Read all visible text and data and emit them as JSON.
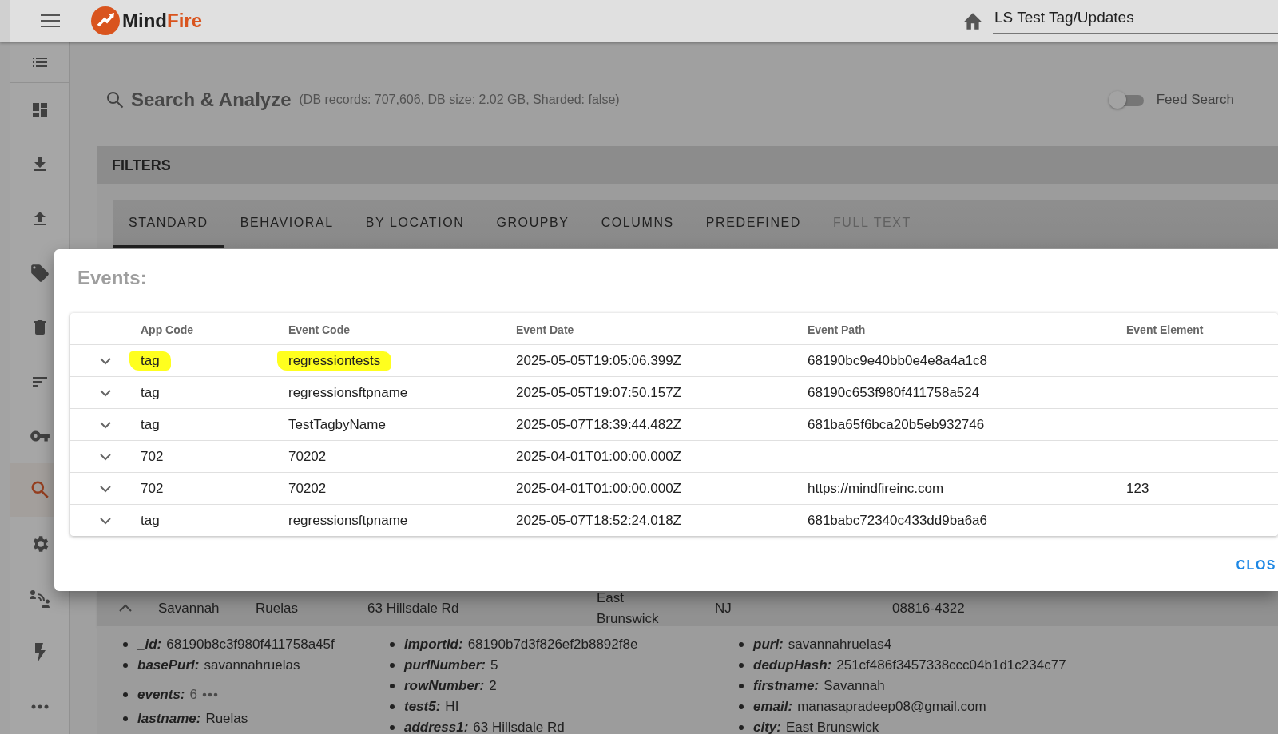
{
  "top_bar": {
    "logo": {
      "text": "Mind",
      "accent": "Fire"
    },
    "breadcrumb": "LS Test Tag/Updates"
  },
  "sidebar": {
    "items": [
      {
        "kind": "list",
        "selected": false
      },
      {
        "kind": "dashboard",
        "selected": false
      },
      {
        "kind": "download",
        "selected": false
      },
      {
        "kind": "upload",
        "selected": false
      },
      {
        "kind": "tag",
        "selected": false
      },
      {
        "kind": "trash",
        "selected": false
      },
      {
        "kind": "sort",
        "selected": false
      },
      {
        "kind": "key",
        "selected": false
      },
      {
        "kind": "search",
        "selected": true
      },
      {
        "kind": "gear",
        "selected": false
      },
      {
        "kind": "people",
        "selected": false
      },
      {
        "kind": "bolt",
        "selected": false
      },
      {
        "kind": "more",
        "selected": false
      }
    ]
  },
  "header": {
    "title": "Search & Analyze",
    "subtitle": "(DB records: 707,606, DB size: 2.02 GB, Sharded: false)",
    "feed_search": {
      "label": "Feed Search",
      "on": false
    }
  },
  "filters": {
    "title": "FILTERS",
    "tabs": [
      {
        "label": "STANDARD",
        "selected": true,
        "disabled": false
      },
      {
        "label": "BEHAVIORAL",
        "selected": false,
        "disabled": false
      },
      {
        "label": "BY LOCATION",
        "selected": false,
        "disabled": false
      },
      {
        "label": "GROUPBY",
        "selected": false,
        "disabled": false
      },
      {
        "label": "COLUMNS",
        "selected": false,
        "disabled": false
      },
      {
        "label": "PREDEFINED",
        "selected": false,
        "disabled": false
      },
      {
        "label": "FULL TEXT",
        "selected": false,
        "disabled": true
      }
    ]
  },
  "record": {
    "expanded": true,
    "cells": [
      "Savannah",
      "Ruelas",
      "63 Hillsdale Rd",
      "East Brunswick",
      "NJ",
      "08816-4322"
    ],
    "details": [
      [
        {
          "key": "_id:",
          "value": "68190b8c3f980f411758a45f"
        },
        {
          "key": "basePurl:",
          "value": "savannahruelas"
        },
        {
          "key": "events:",
          "value": "6",
          "kind": "more"
        },
        {
          "key": "lastname:",
          "value": "Ruelas"
        }
      ],
      [
        {
          "key": "importId:",
          "value": "68190b7d3f826ef2b8892f8e"
        },
        {
          "key": "purlNumber:",
          "value": "5"
        },
        {
          "key": "rowNumber:",
          "value": "2"
        },
        {
          "key": "test5:",
          "value": "HI"
        },
        {
          "key": "address1:",
          "value": "63 Hillsdale Rd"
        }
      ],
      [
        {
          "key": "purl:",
          "value": "savannahruelas4"
        },
        {
          "key": "dedupHash:",
          "value": "251cf486f3457338ccc04b1d1c234c77"
        },
        {
          "key": "firstname:",
          "value": "Savannah"
        },
        {
          "key": "email:",
          "value": "manasapradeep08@gmail.com"
        },
        {
          "key": "city:",
          "value": "East Brunswick"
        }
      ]
    ]
  },
  "dialog": {
    "title": "Events:",
    "columns": [
      "App Code",
      "Event Code",
      "Event Date",
      "Event Path",
      "Event Element"
    ],
    "rows": [
      {
        "app_code": "tag",
        "event_code": "regressiontests",
        "event_date": "2025-05-05T19:05:06.399Z",
        "event_path": "68190bc9e40bb0e4e8a4a1c8",
        "highlighted": true
      },
      {
        "app_code": "tag",
        "event_code": "regressionsftpname",
        "event_date": "2025-05-05T19:07:50.157Z",
        "event_path": "68190c653f980f411758a524",
        "highlighted": false
      },
      {
        "app_code": "tag",
        "event_code": "TestTagbyName",
        "event_date": "2025-05-07T18:39:44.482Z",
        "event_path": "681ba65f6bca20b5eb932746",
        "highlighted": false
      },
      {
        "app_code": "702",
        "event_code": "70202",
        "event_date": "2025-04-01T01:00:00.000Z",
        "highlighted": false
      },
      {
        "app_code": "702",
        "event_code": "70202",
        "event_date": "2025-04-01T01:00:00.000Z",
        "event_path": "https://mindfireinc.com",
        "event_element": "123",
        "highlighted": false
      },
      {
        "app_code": "tag",
        "event_code": "regressionsftpname",
        "event_date": "2025-05-07T18:52:24.018Z",
        "event_path": "681babc72340c433dd9ba6a6",
        "highlighted": false
      }
    ],
    "close_label": "CLOS"
  }
}
